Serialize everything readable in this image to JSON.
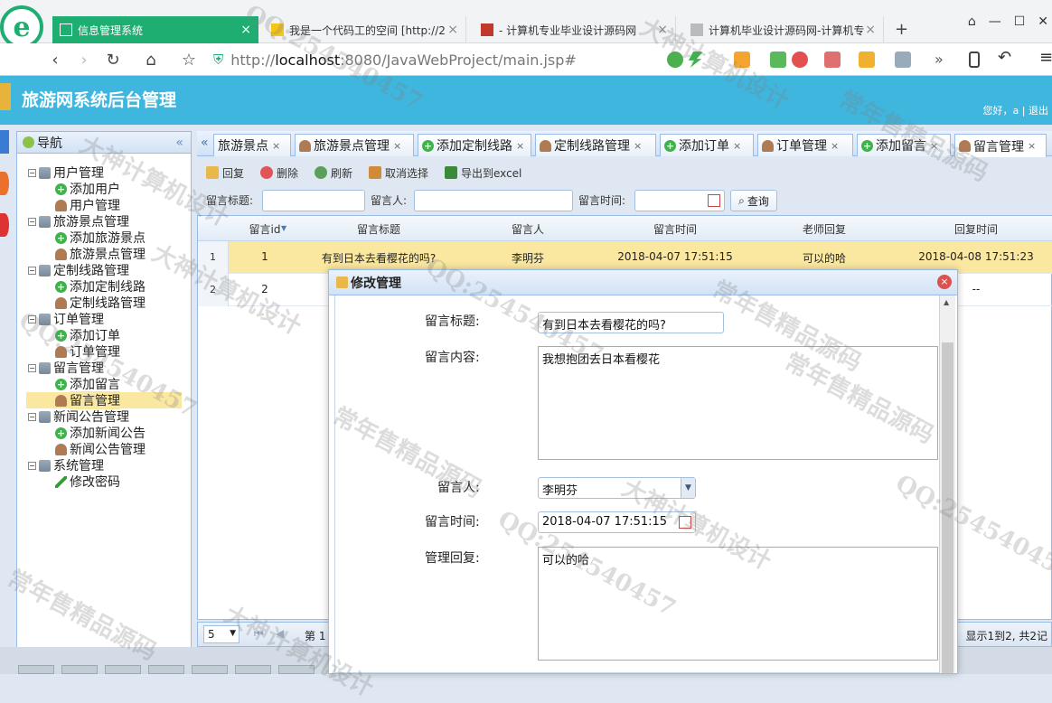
{
  "browser": {
    "tabs": [
      {
        "label": "信息管理系统",
        "active": true
      },
      {
        "label": "我是一个代码工的空间 [http://2",
        "active": false
      },
      {
        "label": "- 计算机专业毕业设计源码网",
        "active": false
      },
      {
        "label": "计算机毕业设计源码网-计算机专",
        "active": false
      }
    ],
    "new_tab": "+",
    "url_prefix": "http://",
    "url_host": "localhost",
    "url_rest": ":8080/JavaWebProject/main.jsp#",
    "more": "»"
  },
  "app": {
    "title": "旅游网系统后台管理",
    "greeting": "您好，a  |  退出"
  },
  "sidebar": {
    "title": "导航",
    "collapse": "«",
    "groups": [
      {
        "label": "用户管理",
        "items": [
          "添加用户",
          "用户管理"
        ]
      },
      {
        "label": "旅游景点管理",
        "items": [
          "添加旅游景点",
          "旅游景点管理"
        ]
      },
      {
        "label": "定制线路管理",
        "items": [
          "添加定制线路",
          "定制线路管理"
        ]
      },
      {
        "label": "订单管理",
        "items": [
          "添加订单",
          "订单管理"
        ]
      },
      {
        "label": "留言管理",
        "items": [
          "添加留言",
          "留言管理"
        ]
      },
      {
        "label": "新闻公告管理",
        "items": [
          "添加新闻公告",
          "新闻公告管理"
        ]
      },
      {
        "label": "系统管理",
        "items": [
          "修改密码"
        ]
      }
    ]
  },
  "tabs": {
    "scroll_left": "«",
    "items": [
      "旅游景点",
      "旅游景点管理",
      "添加定制线路",
      "定制线路管理",
      "添加订单",
      "订单管理",
      "添加留言",
      "留言管理"
    ],
    "close": "×"
  },
  "toolbar": {
    "reply": "回复",
    "delete": "删除",
    "refresh": "刷新",
    "cancel_select": "取消选择",
    "export": "导出到excel"
  },
  "search": {
    "title_label": "留言标题:",
    "user_label": "留言人:",
    "time_label": "留言时间:",
    "query": "查询"
  },
  "grid": {
    "columns": [
      "留言id",
      "留言标题",
      "留言人",
      "留言时间",
      "老师回复",
      "回复时间"
    ],
    "rows": [
      {
        "num": "1",
        "id": "1",
        "title": "有到日本去看樱花的吗?",
        "user": "李明芬",
        "time": "2018-04-07 17:51:15",
        "reply": "可以的哈",
        "reply_time": "2018-04-08 17:51:23"
      },
      {
        "num": "2",
        "id": "2",
        "title": "",
        "user": "",
        "time": "",
        "reply": "",
        "reply_time": "--"
      }
    ]
  },
  "pager": {
    "page_size": "5",
    "page_label": "第 1",
    "summary": "显示1到2, 共2记"
  },
  "dialog": {
    "title": "修改管理",
    "close": "×",
    "fields": {
      "title_label": "留言标题:",
      "title_value": "有到日本去看樱花的吗?",
      "content_label": "留言内容:",
      "content_value": "我想抱团去日本看樱花",
      "user_label": "留言人:",
      "user_value": "李明芬",
      "time_label": "留言时间:",
      "time_value": "2018-04-07 17:51:15",
      "reply_label": "管理回复:",
      "reply_value": "可以的哈"
    }
  },
  "watermarks": [
    "QQ:254540457",
    "常年售精品源码",
    "大神计算机设计"
  ]
}
